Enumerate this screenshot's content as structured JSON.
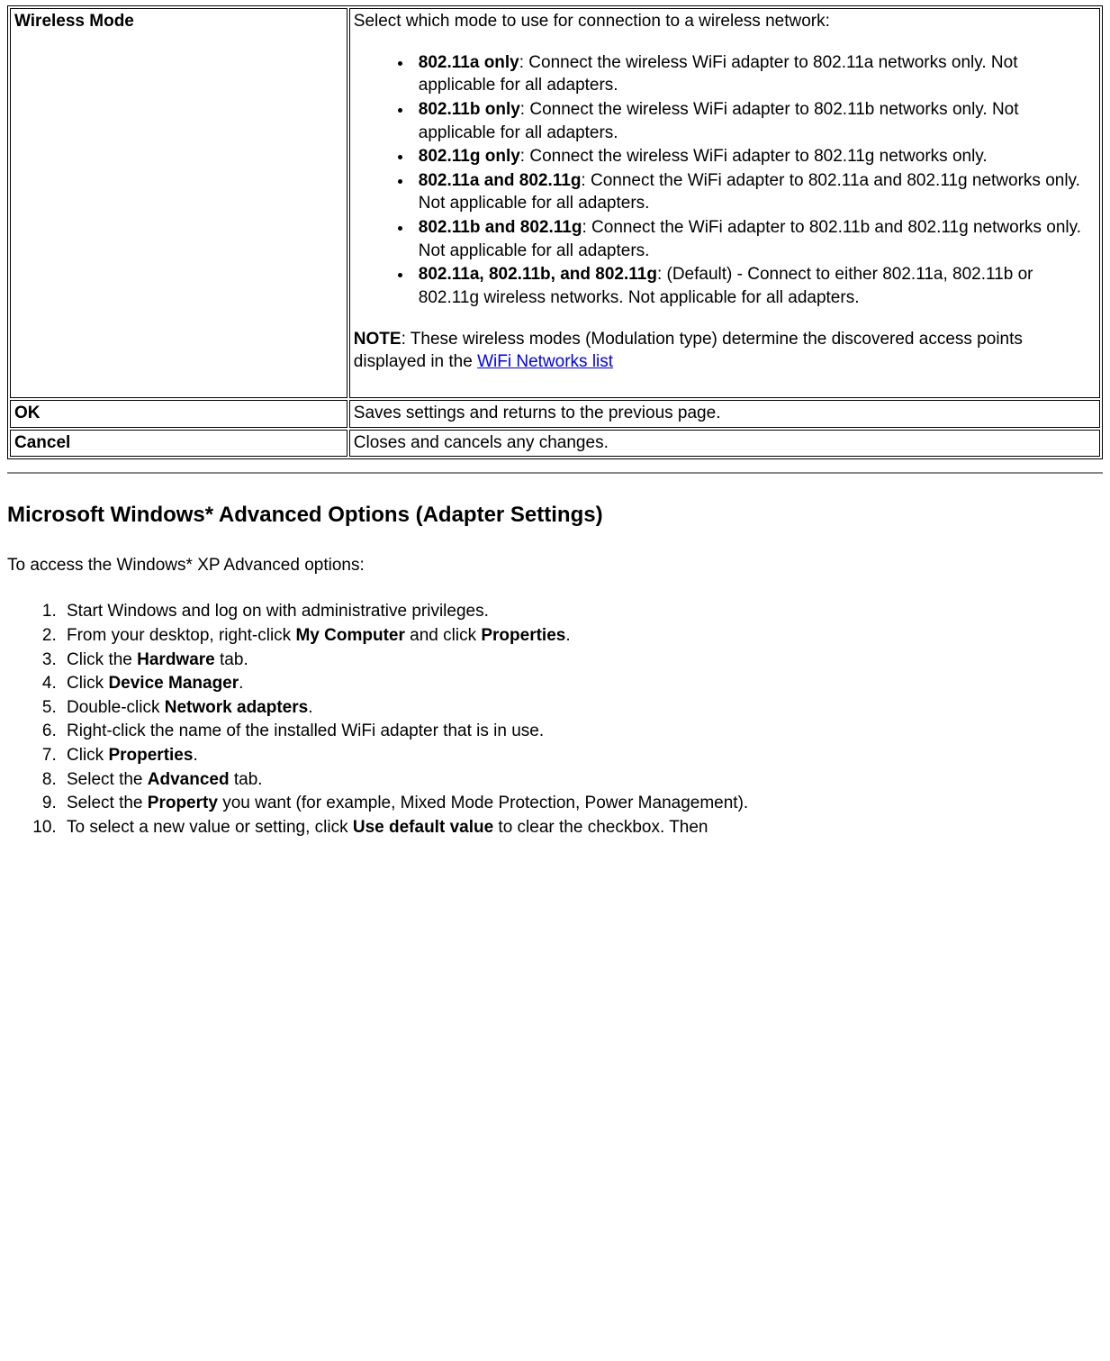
{
  "rows": {
    "wireless": {
      "label": "Wireless Mode",
      "intro": "Select which mode to use for connection to a wireless network:",
      "b0": "802.11a only",
      "t0": ": Connect the wireless WiFi adapter to 802.11a networks only. Not applicable for all adapters.",
      "b1": "802.11b only",
      "t1": ": Connect the wireless WiFi adapter to 802.11b networks only. Not applicable for all adapters.",
      "b2": "802.11g only",
      "t2": ": Connect the wireless WiFi adapter to 802.11g networks only.",
      "b3": "802.11a and 802.11g",
      "t3": ": Connect the WiFi adapter to 802.11a and 802.11g networks only. Not applicable for all adapters.",
      "b4": "802.11b and 802.11g",
      "t4": ": Connect the WiFi adapter to 802.11b and 802.11g networks only. Not applicable for all adapters.",
      "b5": "802.11a, 802.11b, and 802.11g",
      "t5": ": (Default) - Connect to either 802.11a, 802.11b or 802.11g wireless networks. Not applicable for all adapters.",
      "note_b": "NOTE",
      "note_t1": ": These wireless modes (Modulation type) determine the discovered access points displayed in the ",
      "note_link": "WiFi Networks list"
    },
    "ok": {
      "label": "OK",
      "desc": "Saves settings and returns to the previous page."
    },
    "cancel": {
      "label": "Cancel",
      "desc": "Closes and cancels any changes."
    }
  },
  "heading": "Microsoft Windows* Advanced Options (Adapter Settings)",
  "intro": "To access the Windows* XP Advanced options:",
  "steps": {
    "s1": "Start Windows and log on with administrative privileges.",
    "s2a": "From your desktop, right-click ",
    "s2b": "My Computer",
    "s2c": " and click ",
    "s2d": "Properties",
    "s2e": ".",
    "s3a": "Click the ",
    "s3b": "Hardware",
    "s3c": " tab.",
    "s4a": "Click ",
    "s4b": "Device Manager",
    "s4c": ".",
    "s5a": "Double-click ",
    "s5b": "Network adapters",
    "s5c": ".",
    "s6": "Right-click the name of the installed WiFi adapter that is in use.",
    "s7a": "Click ",
    "s7b": "Properties",
    "s7c": ".",
    "s8a": "Select the ",
    "s8b": "Advanced",
    "s8c": " tab.",
    "s9a": "Select the ",
    "s9b": "Property",
    "s9c": " you want (for example, Mixed Mode Protection, Power Management).",
    "s10a": "To select a new value or setting, click ",
    "s10b": "Use default value",
    "s10c": " to clear the checkbox. Then"
  }
}
